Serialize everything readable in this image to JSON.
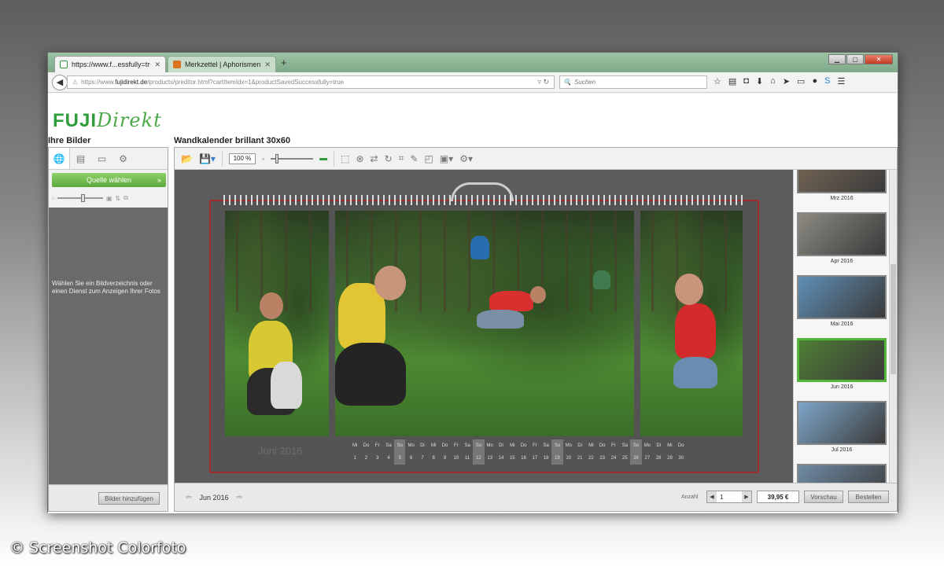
{
  "browser": {
    "tabs": [
      {
        "label": "https://www.f...essfully=true",
        "favicon_color": "#2e9e3a"
      },
      {
        "label": "Merkzettel | Aphorismen.de",
        "favicon_color": "#d9731d"
      }
    ],
    "new_tab": "+",
    "url_prefix": "https://www.",
    "url_domain": "fujidirekt.de",
    "url_path": "/products/preditor.html?cartItemIdx=1&productSavedSuccessfully=true",
    "search_placeholder": "Suchen",
    "nav_icons": [
      "bookmark-star-icon",
      "reading-list-icon",
      "pocket-icon",
      "download-icon",
      "home-icon",
      "send-icon",
      "screen-icon",
      "chat-icon",
      "skype-icon",
      "menu-icon"
    ]
  },
  "page": {
    "logo_fuji": "FUJI",
    "logo_direkt": "Direkt",
    "left_title": "Ihre Bilder",
    "product_title": "Wandkalender brillant 30x60"
  },
  "left_panel": {
    "source_button": "Quelle wählen",
    "hint": "Wählen Sie ein Bildverzeichnis oder einen Dienst zum Anzeigen Ihrer Fotos",
    "add_button": "Bilder hinzufügen"
  },
  "toolbar": {
    "zoom": "100 %"
  },
  "calendar": {
    "month_label": "Juni 2016",
    "weekday_abbrevs": [
      "Mi",
      "Do",
      "Fr",
      "Sa",
      "So",
      "Mo",
      "Di",
      "Mi",
      "Do",
      "Fr",
      "Sa",
      "So",
      "Mo",
      "Di",
      "Mi",
      "Do",
      "Fr",
      "Sa",
      "So",
      "Mo",
      "Di",
      "Mi",
      "Do",
      "Fr",
      "Sa",
      "So",
      "Mo",
      "Di",
      "Mi",
      "Do"
    ],
    "days": [
      1,
      2,
      3,
      4,
      5,
      6,
      7,
      8,
      9,
      10,
      11,
      12,
      13,
      14,
      15,
      16,
      17,
      18,
      19,
      20,
      21,
      22,
      23,
      24,
      25,
      26,
      27,
      28,
      29,
      30
    ],
    "sundays": [
      5,
      12,
      19,
      26
    ]
  },
  "thumbnails": [
    {
      "caption": "Mrz 2016",
      "color": "#7a6a58"
    },
    {
      "caption": "Apr 2016",
      "color": "#8c8a82"
    },
    {
      "caption": "Mai 2016",
      "color": "#5f8fb5"
    },
    {
      "caption": "Jun 2016",
      "color": "#4e7e34",
      "selected": true
    },
    {
      "caption": "Jul 2016",
      "color": "#7ea6c9"
    },
    {
      "caption": "",
      "color": "#6f8aa3"
    }
  ],
  "footer": {
    "page_label": "Jun 2016",
    "qty_label": "Anzahl",
    "qty_value": "1",
    "price": "39,95 €",
    "preview_button": "Vorschau",
    "order_button": "Bestellen"
  },
  "credit": "© Screenshot Colorfoto"
}
